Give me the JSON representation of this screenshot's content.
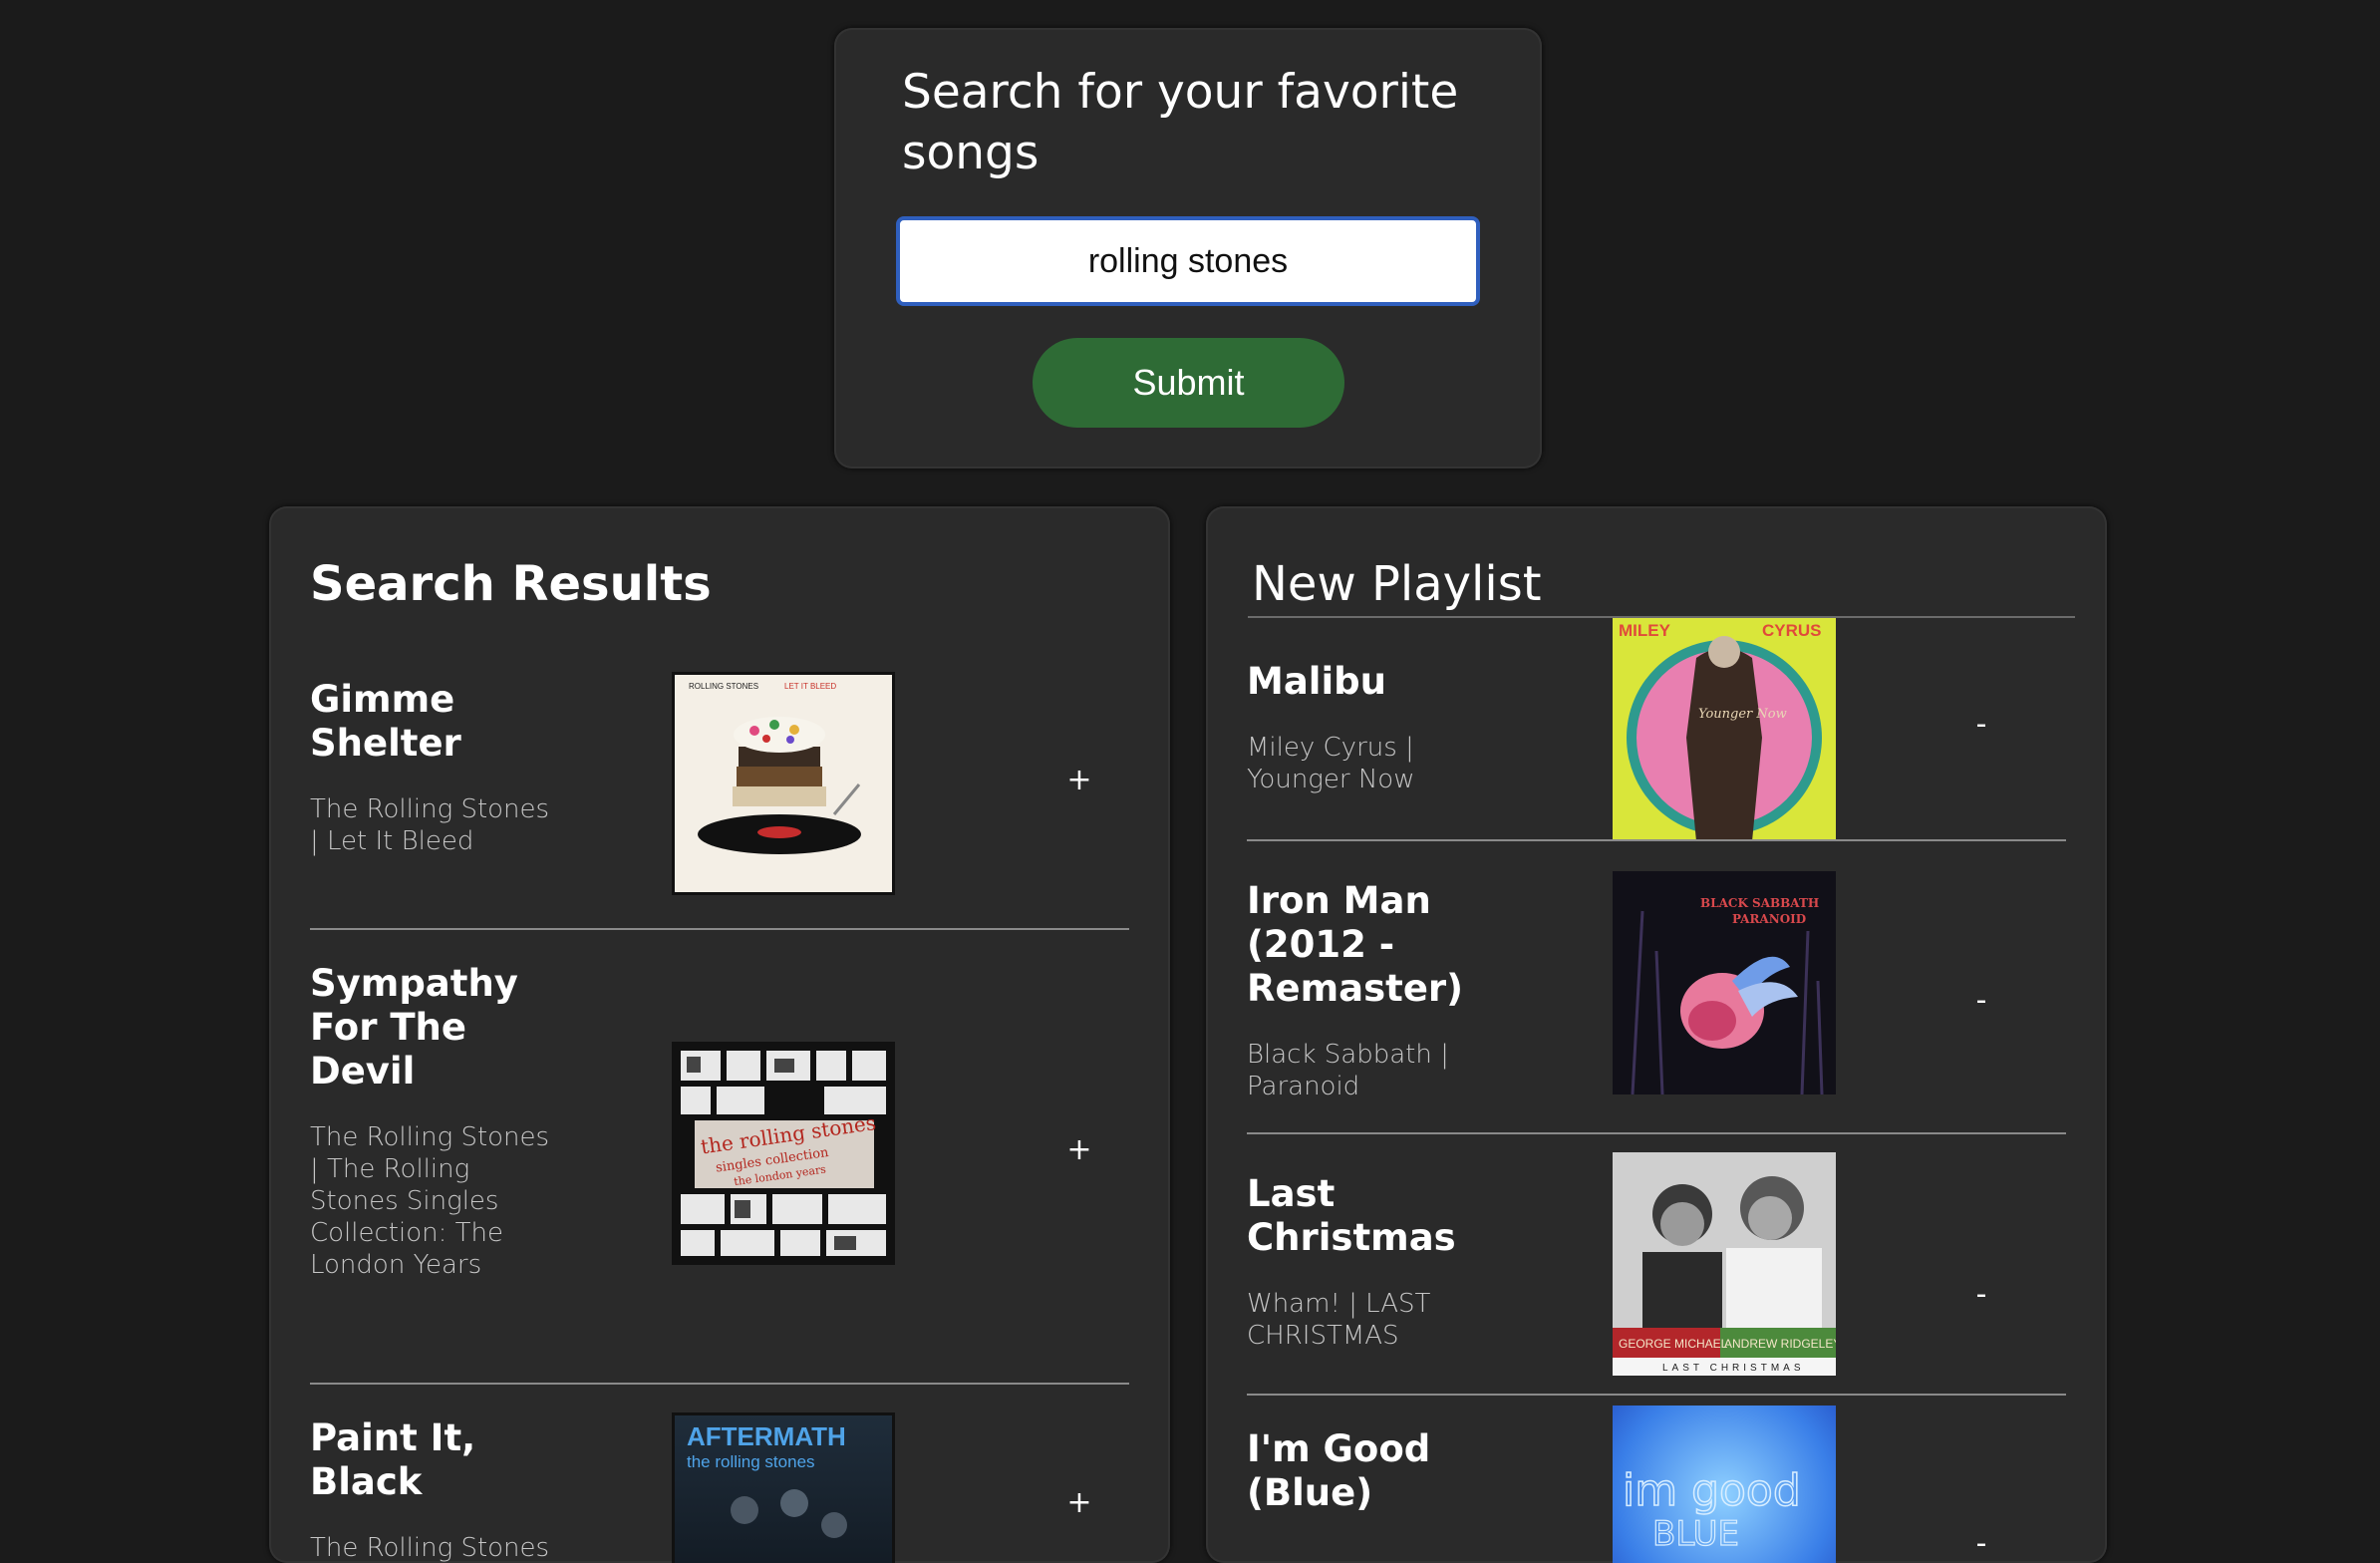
{
  "search": {
    "title": "Search for your favorite songs",
    "query": "rolling stones",
    "submit_label": "Submit"
  },
  "results": {
    "heading": "Search Results",
    "add_label": "+",
    "tracks": [
      {
        "name": "Gimme Shelter",
        "meta": "The Rolling Stones | Let It Bleed"
      },
      {
        "name": "Sympathy For The Devil",
        "meta": "The Rolling Stones | The Rolling Stones Singles Collection: The London Years"
      },
      {
        "name": "Paint It, Black",
        "meta": "The Rolling Stones | Aftermath"
      }
    ]
  },
  "playlist": {
    "name": "New Playlist",
    "remove_label": "-",
    "tracks": [
      {
        "name": "Malibu",
        "meta": "Miley Cyrus | Younger Now"
      },
      {
        "name": "Iron Man (2012 - Remaster)",
        "meta": "Black Sabbath | Paranoid"
      },
      {
        "name": "Last Christmas",
        "meta": "Wham! | LAST CHRISTMAS"
      },
      {
        "name": "I'm Good (Blue)",
        "meta": ""
      }
    ]
  },
  "covers": {
    "let_it_bleed": {
      "band": "ROLLING STONES",
      "title": "LET IT BLEED"
    },
    "singles_collection": {
      "title": "the rolling stones",
      "subtitle": "singles collection",
      "subtitle2": "the london years"
    },
    "aftermath": {
      "title": "AFTERMATH",
      "subtitle": "the rolling stones"
    },
    "younger_now": {
      "left": "MILEY",
      "right": "CYRUS",
      "script": "Younger Now"
    },
    "paranoid": {
      "band": "BLACK SABBATH",
      "title": "PARANOID"
    },
    "last_christmas": {
      "left": "GEORGE MICHAEL",
      "right": "ANDREW RIDGELEY",
      "bottom": "LAST CHRISTMAS"
    },
    "im_good": {
      "title": "im good",
      "subtitle": "BLUE"
    }
  },
  "colors": {
    "background": "#1b1b1b",
    "card": "#2a2a2a",
    "submit": "#2e6b35",
    "input_border": "#2f5fbe"
  }
}
